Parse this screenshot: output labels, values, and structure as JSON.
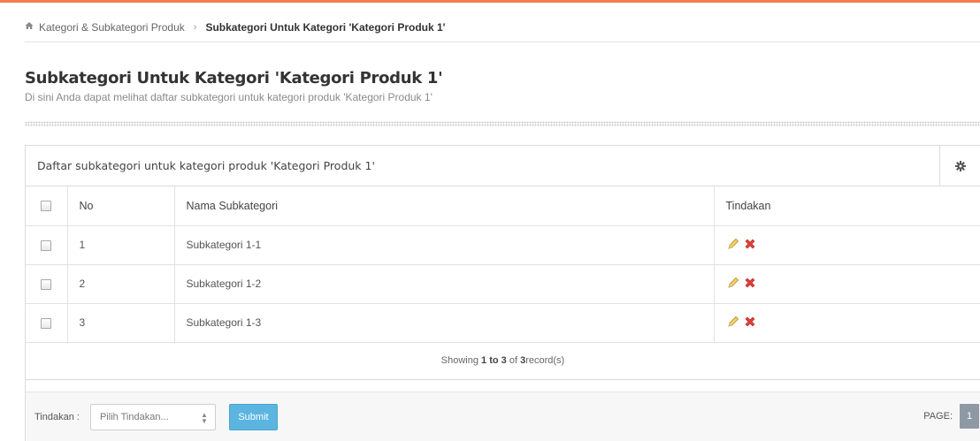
{
  "breadcrumb": {
    "parent": "Kategori & Subkategori Produk",
    "current": "Subkategori Untuk Kategori 'Kategori Produk 1'"
  },
  "header": {
    "title": "Subkategori Untuk Kategori 'Kategori Produk 1'",
    "subtitle": "Di sini Anda dapat melihat daftar subkategori untuk kategori produk 'Kategori Produk 1'"
  },
  "panel": {
    "title": "Daftar subkategori untuk kategori produk 'Kategori Produk 1'"
  },
  "table": {
    "columns": {
      "no": "No",
      "name": "Nama Subkategori",
      "actions": "Tindakan"
    },
    "rows": [
      {
        "no": "1",
        "name": "Subkategori 1-1"
      },
      {
        "no": "2",
        "name": "Subkategori 1-2"
      },
      {
        "no": "3",
        "name": "Subkategori 1-3"
      }
    ]
  },
  "status": {
    "prefix": "Showing ",
    "range": "1 to 3",
    "mid": " of ",
    "total": "3",
    "suffix": " record(s)"
  },
  "bulk": {
    "label": "Tindakan :",
    "select_placeholder": "Pilih Tindakan...",
    "submit_label": "Submit"
  },
  "pagination": {
    "label": "PAGE:",
    "current": "1"
  },
  "colors": {
    "accent_top": "#f47c4a",
    "submit": "#5bb5e0",
    "page_badge": "#8e99a5"
  }
}
